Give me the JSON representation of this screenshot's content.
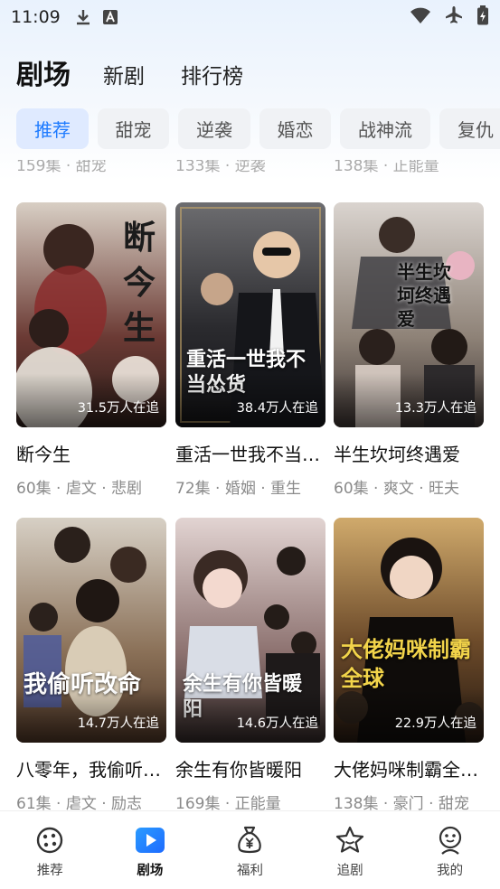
{
  "status": {
    "time": "11:09"
  },
  "top_tabs": [
    {
      "label": "剧场",
      "active": true
    },
    {
      "label": "新剧",
      "active": false
    },
    {
      "label": "排行榜",
      "active": false
    }
  ],
  "chips": [
    {
      "label": "推荐",
      "active": true
    },
    {
      "label": "甜宠"
    },
    {
      "label": "逆袭"
    },
    {
      "label": "婚恋"
    },
    {
      "label": "战神流"
    },
    {
      "label": "复仇"
    }
  ],
  "prev_row": [
    "159集 · 甜宠",
    "133集 · 逆袭",
    "138集 · 正能量"
  ],
  "cards": [
    {
      "title": "断今生",
      "meta": "60集 · 虐文 · 悲剧",
      "watchers": "31.5万人在追",
      "poster_text": "断今生",
      "colors": [
        "#d8cfc4",
        "#6b3a34",
        "#2a1c18"
      ]
    },
    {
      "title": "重活一世我不当…",
      "meta": "72集 · 婚姻 · 重生",
      "watchers": "38.4万人在追",
      "poster_text": "重活一世我不当怂货",
      "colors": [
        "#6d6d70",
        "#2b2b2f",
        "#121214"
      ]
    },
    {
      "title": "半生坎坷终遇爱",
      "meta": "60集 · 爽文 · 旺夫",
      "watchers": "13.3万人在追",
      "poster_text": "半生坎坷终遇爱",
      "colors": [
        "#dad4cf",
        "#8e8277",
        "#3a3230"
      ]
    },
    {
      "title": "八零年，我偷听…",
      "meta": "61集 · 虐文 · 励志",
      "watchers": "14.7万人在追",
      "poster_text": "我偷听改命",
      "colors": [
        "#d7d0c5",
        "#8a7057",
        "#4a3324"
      ]
    },
    {
      "title": "余生有你皆暖阳",
      "meta": "169集 · 正能量",
      "watchers": "14.6万人在追",
      "poster_text": "余生有你皆暖阳",
      "colors": [
        "#e2d4d2",
        "#8d7270",
        "#2f2625"
      ]
    },
    {
      "title": "大佬妈咪制霸全…",
      "meta": "138集 · 豪门 · 甜宠",
      "watchers": "22.9万人在追",
      "poster_text": "大佬妈咪制霸全球",
      "colors": [
        "#d0aa6c",
        "#6d4b2a",
        "#241810"
      ]
    }
  ],
  "bottom_tabs": [
    {
      "label": "推荐",
      "icon": "dice-icon"
    },
    {
      "label": "剧场",
      "icon": "play-icon",
      "active": true
    },
    {
      "label": "福利",
      "icon": "money-bag-icon"
    },
    {
      "label": "追剧",
      "icon": "star-icon"
    },
    {
      "label": "我的",
      "icon": "profile-icon"
    }
  ],
  "accent": "#1e7bff"
}
